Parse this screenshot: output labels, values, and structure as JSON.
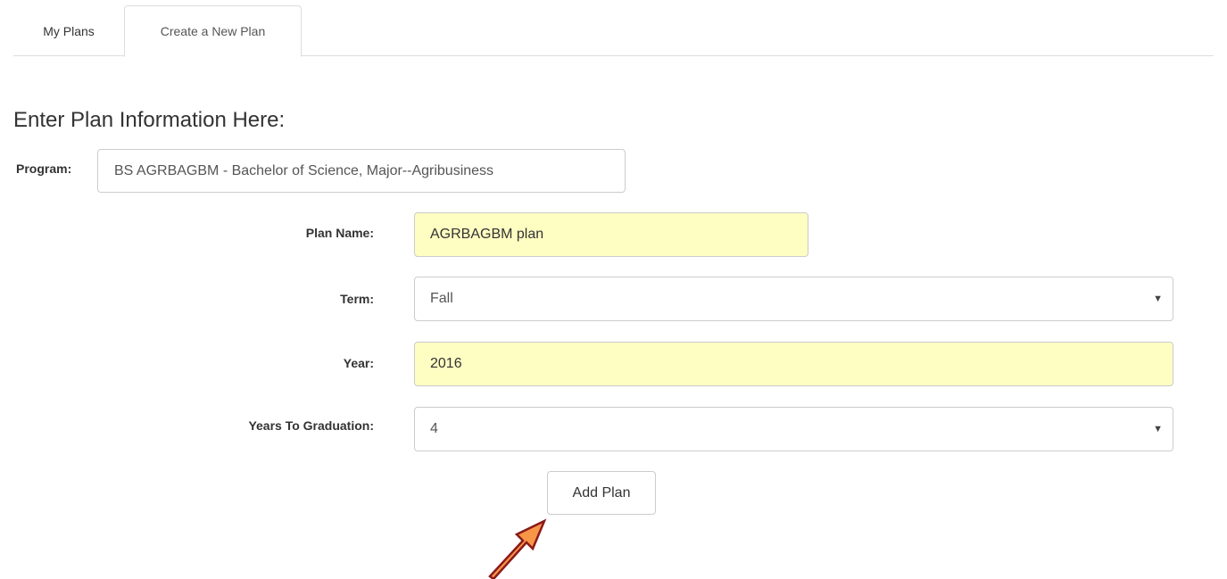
{
  "tabs": [
    {
      "label": "My Plans",
      "active": false
    },
    {
      "label": "Create a New Plan",
      "active": true
    }
  ],
  "heading": "Enter Plan Information Here:",
  "program": {
    "label": "Program:",
    "value": "BS AGRBAGBM - Bachelor of Science, Major--Agribusiness"
  },
  "form": {
    "plan_name": {
      "label": "Plan Name:",
      "value": "AGRBAGBM plan"
    },
    "term": {
      "label": "Term:",
      "value": "Fall"
    },
    "year": {
      "label": "Year:",
      "value": "2016"
    },
    "years_to_graduation": {
      "label": "Years To Graduation:",
      "value": "4"
    }
  },
  "add_button_label": "Add Plan",
  "icons": {
    "select_caret": "chevron-down-icon",
    "annotation_arrow": "arrow-icon"
  },
  "colors": {
    "input_highlight": "#fefdc2",
    "arrow_fill": "#f79646",
    "arrow_stroke": "#8b1a1a",
    "border": "#cccccc"
  }
}
